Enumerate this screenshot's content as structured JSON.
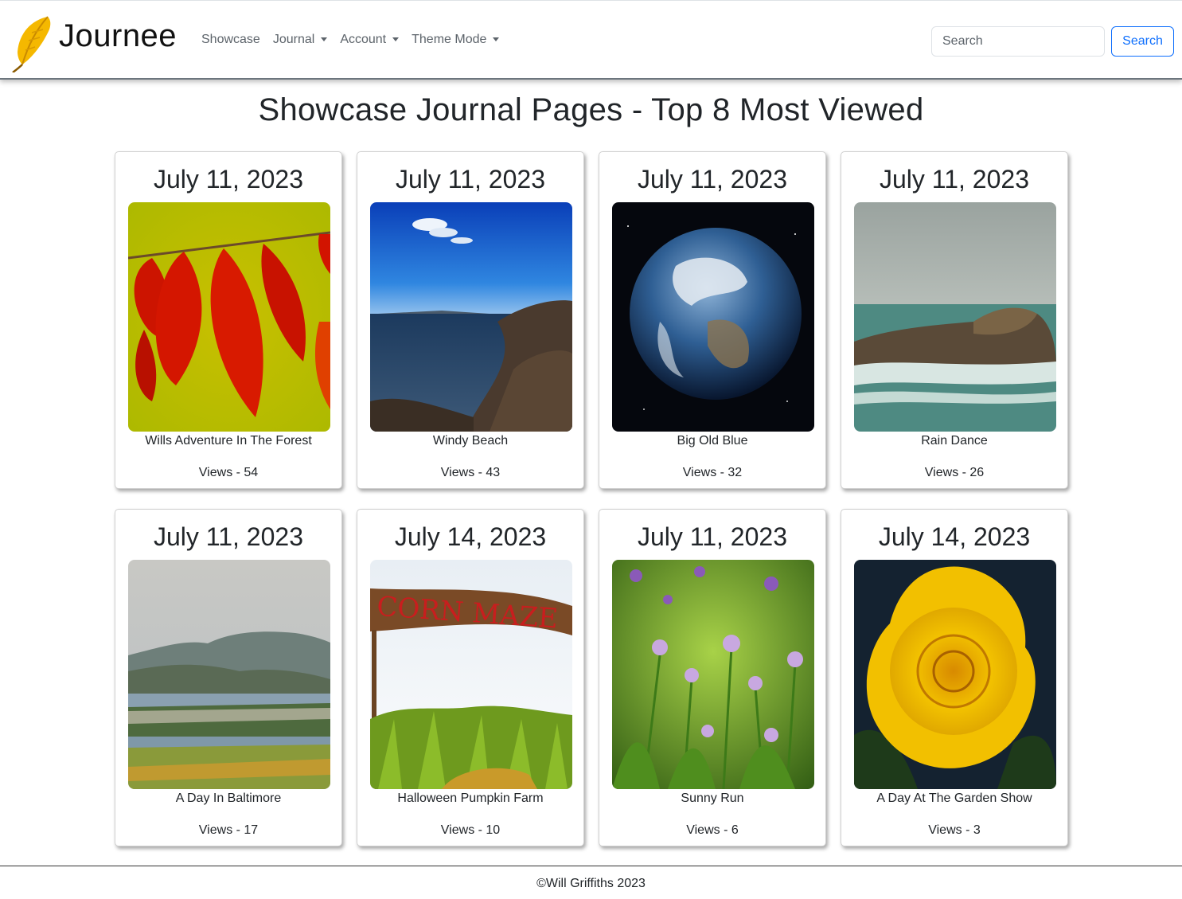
{
  "app": {
    "name": "Journee"
  },
  "nav": {
    "links": [
      {
        "label": "Showcase",
        "dropdown": false
      },
      {
        "label": "Journal",
        "dropdown": true
      },
      {
        "label": "Account",
        "dropdown": true
      },
      {
        "label": "Theme Mode",
        "dropdown": true
      }
    ]
  },
  "search": {
    "placeholder": "Search",
    "button_label": "Search"
  },
  "page": {
    "title": "Showcase Journal Pages - Top 8 Most Viewed"
  },
  "cards": [
    {
      "date": "July 11, 2023",
      "title": "Wills Adventure In The Forest",
      "views": "Views - 54",
      "image": "red-autumn-leaves"
    },
    {
      "date": "July 11, 2023",
      "title": "Windy Beach",
      "views": "Views - 43",
      "image": "rocky-sea-coast"
    },
    {
      "date": "July 11, 2023",
      "title": "Big Old Blue",
      "views": "Views - 32",
      "image": "planet-earth"
    },
    {
      "date": "July 11, 2023",
      "title": "Rain Dance",
      "views": "Views - 26",
      "image": "rock-island-waves"
    },
    {
      "date": "July 11, 2023",
      "title": "A Day In Baltimore",
      "views": "Views - 17",
      "image": "coastal-town-landscape"
    },
    {
      "date": "July 14, 2023",
      "title": "Halloween Pumpkin Farm",
      "views": "Views - 10",
      "image": "corn-maze-sign"
    },
    {
      "date": "July 11, 2023",
      "title": "Sunny Run",
      "views": "Views - 6",
      "image": "purple-wildflowers"
    },
    {
      "date": "July 14, 2023",
      "title": "A Day At The Garden Show",
      "views": "Views - 3",
      "image": "yellow-rose"
    }
  ],
  "corn_maze_sign_text": "CORN MAZE",
  "footer": {
    "text": "©Will Griffiths 2023"
  },
  "colors": {
    "primary": "#0d6efd",
    "nav_text": "#5c636a",
    "logo_feather": "#f5b800"
  }
}
